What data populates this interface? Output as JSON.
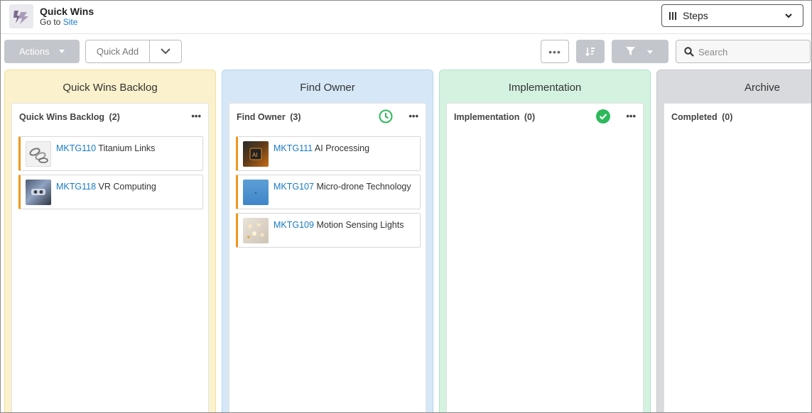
{
  "header": {
    "title": "Quick Wins",
    "goto_prefix": "Go to",
    "goto_link": "Site",
    "view_select": "Steps"
  },
  "toolbar": {
    "actions_label": "Actions",
    "quick_add_label": "Quick Add",
    "more_label": "•••",
    "search_placeholder": "Search"
  },
  "columns": [
    {
      "title": "Quick Wins Backlog",
      "color": "#fbf1cc",
      "lane": {
        "name": "Quick Wins Backlog",
        "count": "(2)",
        "status": ""
      },
      "cards": [
        {
          "id": "MKTG110",
          "name": "Titanium Links",
          "thumb": "links"
        },
        {
          "id": "MKTG118",
          "name": "VR Computing",
          "thumb": "vr"
        }
      ]
    },
    {
      "title": "Find Owner",
      "color": "#d6e8f7",
      "lane": {
        "name": "Find Owner",
        "count": "(3)",
        "status": "clock-icon"
      },
      "cards": [
        {
          "id": "MKTG111",
          "name": "AI Processing",
          "thumb": "ai"
        },
        {
          "id": "MKTG107",
          "name": "Micro-drone Technology",
          "thumb": "sky"
        },
        {
          "id": "MKTG109",
          "name": "Motion Sensing Lights",
          "thumb": "lights"
        }
      ]
    },
    {
      "title": "Implementation",
      "color": "#d4f2e0",
      "lane": {
        "name": "Implementation",
        "count": "(0)",
        "status": "check-circle-icon"
      },
      "cards": []
    },
    {
      "title": "Archive",
      "color": "#d9dadd",
      "lane": {
        "name": "Completed",
        "count": "(0)",
        "status": ""
      },
      "cards": []
    }
  ],
  "colors": {
    "link": "#1a7bc6",
    "card_accent": "#f0961c",
    "status_green": "#2eb85c",
    "button_gray": "#c3c6cc"
  }
}
